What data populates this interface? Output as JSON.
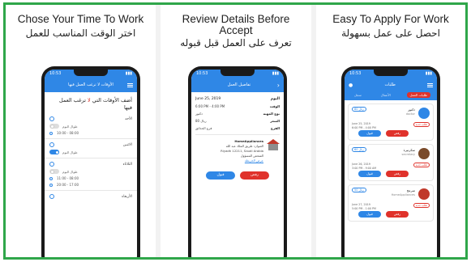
{
  "panel1": {
    "title_en": "Chose Your Time To Work",
    "title_ar": "اختر الوقت المناسب للعمل",
    "phone": {
      "status_time": "10:53",
      "status_right": "▮▮▮",
      "appbar_title": "الأوقات لا ترغب العمل فيها",
      "heading_prefix": "أضف الأوقات التي",
      "heading_red": "لا",
      "heading_suffix": "ترغب العمل فيها",
      "days": [
        {
          "name": "الأحد",
          "toggle_label": "طوال اليوم",
          "toggle_on": false,
          "slots": [
            "10:00 - 08:00"
          ]
        },
        {
          "name": "الاثنين",
          "toggle_label": "طوال اليوم",
          "toggle_on": true,
          "slots": []
        },
        {
          "name": "الثلاثاء",
          "toggle_label": "طوال اليوم",
          "toggle_on": false,
          "slots": [
            "11:00 - 08:00",
            "20:00 - 17:00"
          ]
        },
        {
          "name": "الأربعاء",
          "toggle_label": "",
          "toggle_on": false,
          "slots": []
        }
      ]
    }
  },
  "panel2": {
    "title_en_1": "Review Details Before",
    "title_en_2": "Accept",
    "title_ar": "تعرف على العمل قبل قبوله",
    "phone": {
      "status_time": "10:53",
      "status_right": "▮▮▮",
      "appbar_title": "تفاصيل العمل",
      "date_label": "اليوم",
      "date_value": "June 25, 2019",
      "details": [
        {
          "label": "الوقت",
          "value": "6:00 PM - 4:00 PM"
        },
        {
          "label": "نوع المهنة",
          "value": "دكتور"
        },
        {
          "label": "السعر",
          "value": "80 ريال"
        },
        {
          "label": "الفرع",
          "value": "فرع الحدائق"
        }
      ],
      "company_name": "HomeAppliances",
      "company_address_1": "العنوان: طريق الملك عبد الله",
      "company_address_2": "Riyadh 12211, Saudi Arabia",
      "company_person": "الشخص المسؤول",
      "company_link": "عرض الخريطة",
      "btn_reject": "رفض",
      "btn_accept": "قبول"
    }
  },
  "panel3": {
    "title_en": "Easy To Apply For Work",
    "title_ar": "احصل على عمل بسهولة",
    "phone": {
      "status_time": "10:53",
      "status_right": "▮▮▮",
      "appbar_title": "طلبات",
      "tabs": [
        "طلبات العمل",
        "الأعمال",
        "سجل"
      ],
      "active_tab": 0,
      "jobs": [
        {
          "tag": "80 ريال",
          "name": "دكتور",
          "sub": "doctor",
          "badge": "طلب جديد",
          "line1": "June 25, 2019",
          "line2": "6:00 PM - 4:00 PM",
          "logo_color": "#2f87e6",
          "reject": "رفض",
          "accept": "قبول"
        },
        {
          "tag": "60 ريال",
          "name": "سكرتيرة",
          "sub": "secretary",
          "badge": "طلب جديد",
          "line1": "June 26, 2019",
          "line2": "3:00 PM - 9:00 AM",
          "logo_color": "#7a4a2a",
          "reject": "رفض",
          "accept": "قبول"
        },
        {
          "tag": "50 ريال",
          "name": "مبرمج",
          "sub": "HomeAppliances",
          "badge": "طلب جديد",
          "line1": "June 27, 2019",
          "line2": "5:00 PM - 1:00 PM",
          "logo_color": "#c0392b",
          "reject": "رفض",
          "accept": "قبول"
        }
      ]
    }
  },
  "colors": {
    "frame": "#2fa64a",
    "primary": "#2f87e6",
    "danger": "#e0322b"
  }
}
